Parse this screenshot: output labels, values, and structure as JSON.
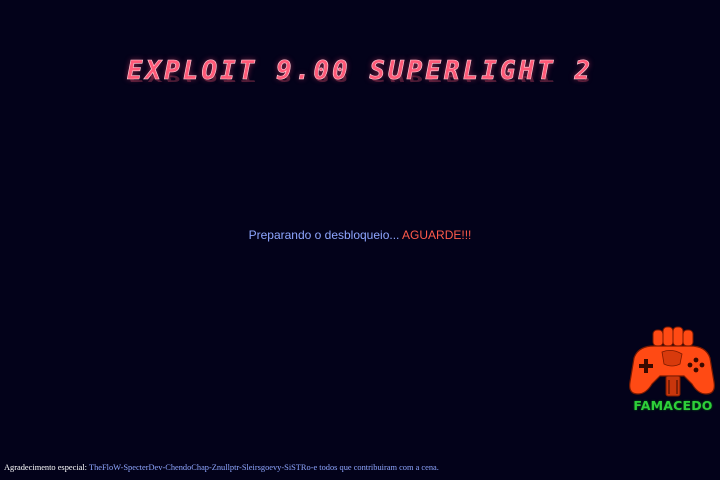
{
  "header": {
    "title": "EXPLOIT 9.00 SUPERLIGHT 2"
  },
  "status": {
    "message": "Preparando o desbloqueio... ",
    "alert": "AGUARDE!!!"
  },
  "logo": {
    "text": "FAMACEDO",
    "icon": "gamepad-fist-icon"
  },
  "footer": {
    "credits_label": "Agradecimento especial:",
    "credits_names": " TheFloW-SpecterDev-ChendoChap-Znullptr-Sleirsgoevy-SiSTRo-e todos que contribuiram com a cena."
  },
  "colors": {
    "background": "#03021a",
    "title": "#ff5a78",
    "status_text": "#8ea6ff",
    "alert_text": "#ff5a4a",
    "logo_green": "#2ecf3a",
    "logo_orange": "#ff4a14"
  }
}
